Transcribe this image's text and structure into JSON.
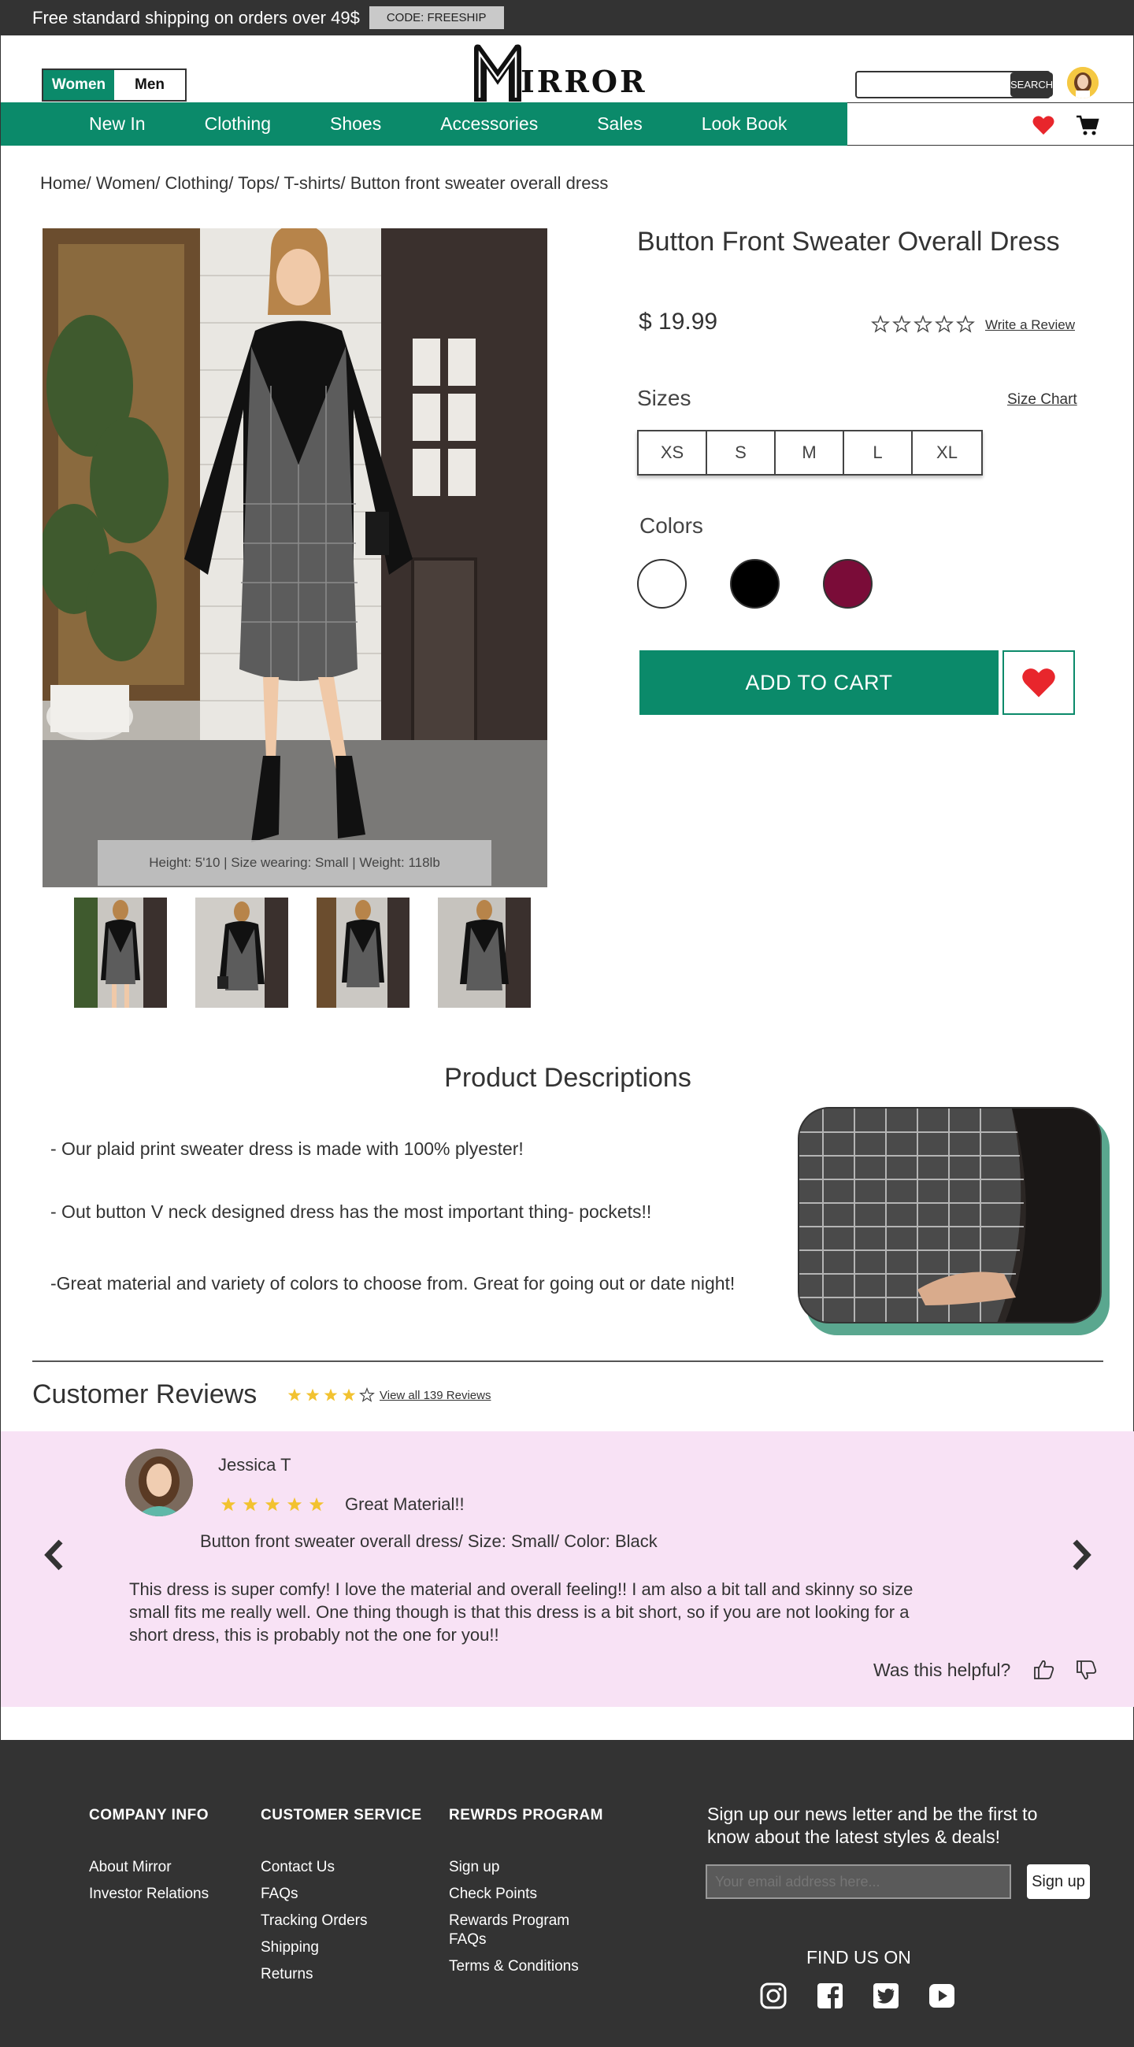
{
  "promo": {
    "text": "Free standard shipping on orders over 49$",
    "code": "CODE: FREESHIP"
  },
  "header": {
    "gender_tabs": [
      "Women",
      "Men"
    ],
    "logo_text": "IRROR",
    "search_button": "SEARCH",
    "search_placeholder": ""
  },
  "nav": {
    "items": [
      "New In",
      "Clothing",
      "Shoes",
      "Accessories",
      "Sales",
      "Look Book"
    ]
  },
  "breadcrumb": "Home/  Women/ Clothing/ Tops/ T-shirts/ Button front sweater overall dress",
  "product": {
    "title": "Button Front Sweater Overall Dress",
    "price": "$ 19.99",
    "rating_stars": 0,
    "write_review": "Write a Review",
    "sizes_label": "Sizes",
    "size_chart": "Size Chart",
    "sizes": [
      "XS",
      "S",
      "M",
      "L",
      "XL"
    ],
    "colors_label": "Colors",
    "colors": [
      "#ffffff",
      "#000000",
      "#7a0c38"
    ],
    "add_to_cart": "ADD TO CART",
    "model_info": "Height: 5'10    |    Size wearing: Small    |    Weight: 118lb"
  },
  "descriptions": {
    "title": "Product Descriptions",
    "lines": [
      "- Our plaid print sweater dress is made with 100% plyester!",
      "- Out button V neck designed dress has the most important thing- pockets!!",
      "-Great material and variety of colors to choose from. Great for going out or date night!"
    ]
  },
  "reviews": {
    "title": "Customer Reviews",
    "rating": 4,
    "view_all": "View all 139 Reviews",
    "review": {
      "name": "Jessica T",
      "stars": 5,
      "headline": "Great Material!!",
      "product_line": "Button front sweater overall dress/ Size: Small/ Color: Black",
      "body": "This dress is super comfy! I love the material and overall feeling!! I am also a bit tall and skinny so size small fits me really well. One thing though is that this dress is a bit short, so if you are not looking for a short dress, this is probably not the one for you!!",
      "helpful": "Was this helpful?"
    }
  },
  "footer": {
    "company": {
      "title": "COMPANY INFO",
      "links": [
        "About Mirror",
        "Investor Relations"
      ]
    },
    "service": {
      "title": "CUSTOMER SERVICE",
      "links": [
        "Contact Us",
        "FAQs",
        "Tracking Orders",
        "Shipping",
        "Returns"
      ]
    },
    "rewards": {
      "title": "REWRDS PROGRAM",
      "links": [
        "Sign up",
        "Check Points",
        "Rewards Program FAQs",
        "Terms & Conditions"
      ]
    },
    "newsletter": "Sign up our news letter and be the first to know about the latest styles & deals!",
    "email_placeholder": "Your email address here...",
    "signup": "Sign up",
    "find_us": "FIND US ON",
    "social": [
      "instagram-icon",
      "facebook-icon",
      "twitter-icon",
      "youtube-icon"
    ]
  },
  "colors": {
    "brand_green": "#0b8a6a",
    "dark": "#333333",
    "review_bg": "#f8e2f5",
    "heart_red": "#e8262c",
    "star_gold": "#f2c230"
  }
}
